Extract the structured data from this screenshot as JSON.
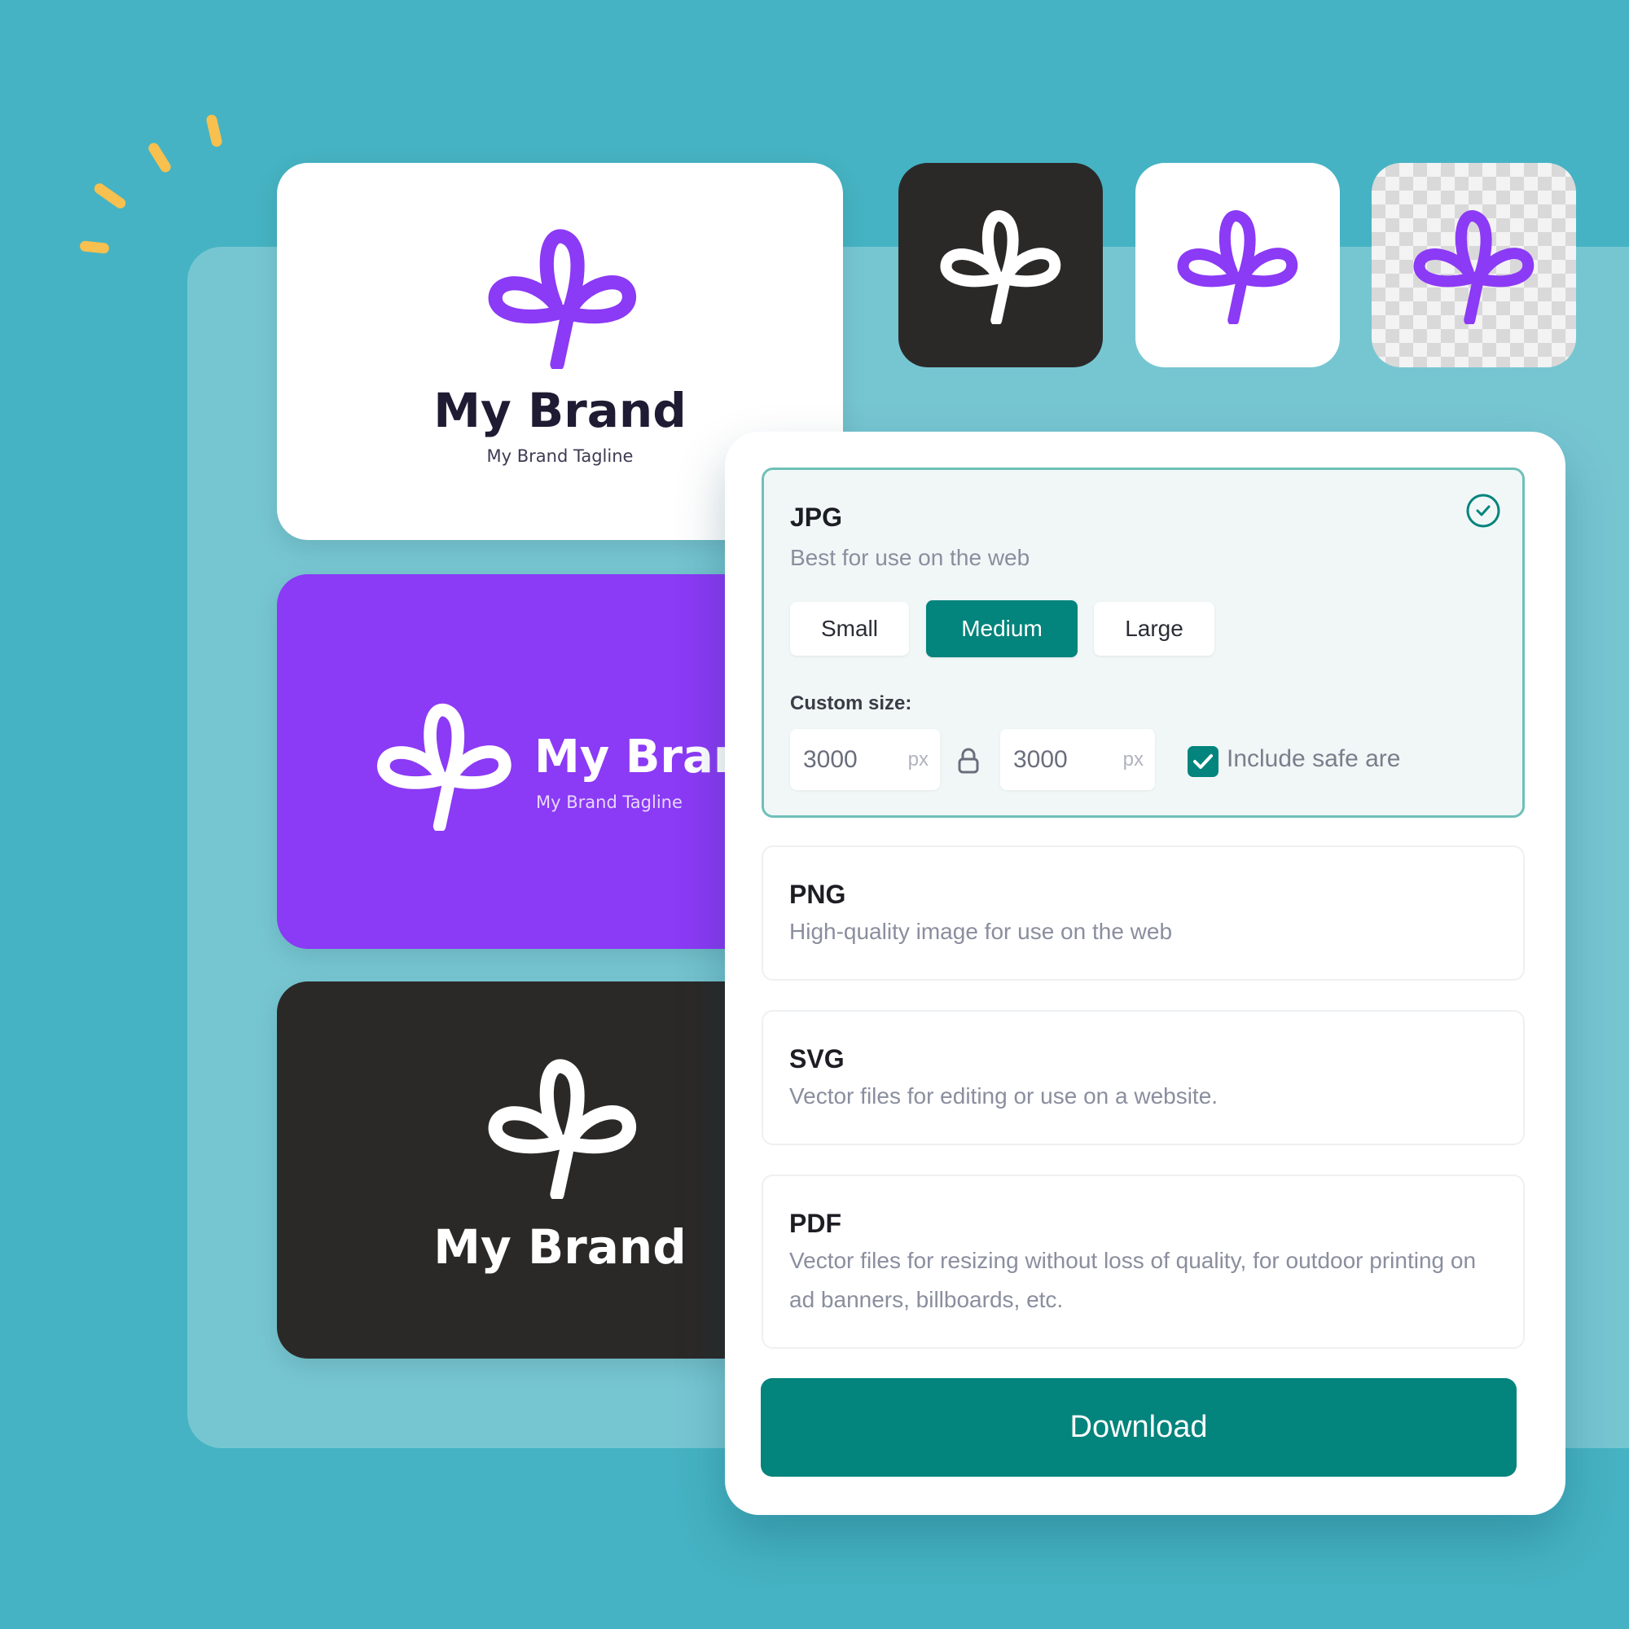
{
  "colors": {
    "background": "#45B3C3",
    "panel": "#76C6D2",
    "accent_teal": "#03847C",
    "brand_purple": "#8B3AF5",
    "dark": "#2B2928",
    "sparkle": "#F8C04E"
  },
  "logo_previews": [
    {
      "variant": "white-background",
      "brand_name": "My Brand",
      "tagline": "My Brand Tagline"
    },
    {
      "variant": "purple-background",
      "brand_name": "My Brand",
      "tagline": "My Brand Tagline"
    },
    {
      "variant": "dark-background",
      "brand_name": "My Brand"
    }
  ],
  "icon_tiles": [
    {
      "variant": "dark",
      "icon": "brand-logo-icon"
    },
    {
      "variant": "white",
      "icon": "brand-logo-icon"
    },
    {
      "variant": "transparent",
      "icon": "brand-logo-icon"
    }
  ],
  "download_modal": {
    "formats": [
      {
        "title": "JPG",
        "description": "Best for use on the web",
        "selected": true,
        "size_options": [
          "Small",
          "Medium",
          "Large"
        ],
        "selected_size": "Medium",
        "custom_size_label": "Custom size:",
        "width_value": "3000",
        "height_value": "3000",
        "unit": "px",
        "include_safe_area_label": "Include safe are",
        "include_safe_area_checked": true
      },
      {
        "title": "PNG",
        "description": "High-quality image for use on the web",
        "selected": false
      },
      {
        "title": "SVG",
        "description": "Vector files for editing or use on a website.",
        "selected": false
      },
      {
        "title": "PDF",
        "description": "Vector files for resizing without loss of quality, for outdoor printing on ad banners, billboards, etc.",
        "selected": false
      }
    ],
    "download_label": "Download"
  }
}
